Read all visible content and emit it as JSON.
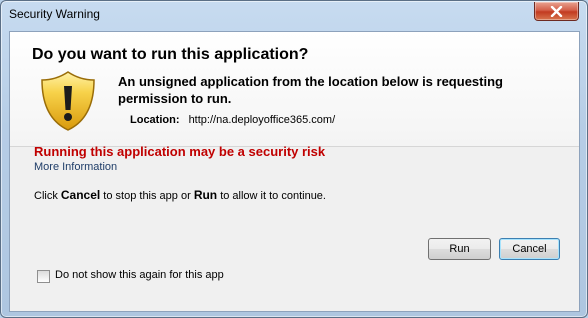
{
  "window": {
    "title": "Security Warning"
  },
  "dialog": {
    "heading": "Do you want to run this application?",
    "description": "An unsigned application from the location below is requesting permission to run.",
    "location_label": "Location:",
    "location_value": "http://na.deployoffice365.com/",
    "risk_text": "Running this application may be a security risk",
    "more_info": "More Information",
    "instructions": {
      "prefix": "Click ",
      "cancel_word": "Cancel",
      "middle": " to stop this app or ",
      "run_word": "Run",
      "suffix": " to allow it to continue."
    }
  },
  "buttons": {
    "run": "Run",
    "cancel": "Cancel"
  },
  "checkbox": {
    "label": "Do not show this again for this app",
    "checked": false
  },
  "icons": {
    "warning": "shield-warning-icon",
    "close": "close-icon"
  },
  "colors": {
    "risk_text": "#c00000",
    "link": "#1f3d68",
    "shield": "#f2c12e"
  }
}
